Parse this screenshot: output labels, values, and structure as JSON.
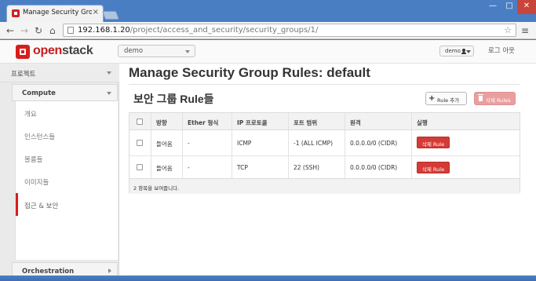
{
  "browser": {
    "tab_title": "Manage Security Group R",
    "tab_close": "×",
    "url_host": "192.168.1.20",
    "url_path": "/project/access_and_security/security_groups/1/",
    "window_min": "—",
    "window_max": "□",
    "window_close": "✕"
  },
  "topbar": {
    "logo_red": "open",
    "logo_dark": "stack",
    "project_select": "demo",
    "user": "demo",
    "logout": "로그 아웃"
  },
  "sidebar": {
    "header": "프로젝트",
    "compute": "Compute",
    "items": [
      {
        "label": "개요"
      },
      {
        "label": "인스턴스들"
      },
      {
        "label": "볼륨들"
      },
      {
        "label": "이미지들"
      },
      {
        "label": "접근 & 보안",
        "active": true
      }
    ],
    "orchestration": "Orchestration"
  },
  "main": {
    "page_title": "Manage Security Group Rules: default",
    "section_title": "보안 그룹 Rule들",
    "add_rule_label": "Rule 추가",
    "delete_rules_label": "삭제 Rules",
    "table": {
      "columns": [
        "방향",
        "Ether 형식",
        "IP 프로토콜",
        "포트 범위",
        "원격",
        "실행"
      ],
      "rows": [
        {
          "direction": "들어옴",
          "ether": "-",
          "protocol": "ICMP",
          "port": "-1 (ALL ICMP)",
          "remote": "0.0.0.0/0 (CIDR)",
          "action": "삭제 Rule"
        },
        {
          "direction": "들어옴",
          "ether": "-",
          "protocol": "TCP",
          "port": "22 (SSH)",
          "remote": "0.0.0.0/0 (CIDR)",
          "action": "삭제 Rule"
        }
      ],
      "footer": "2 항목을 보여줍니다."
    }
  },
  "colors": {
    "brand_red": "#d71e1e",
    "danger_button": "#d53b36",
    "danger_disabled": "#e99f9f"
  }
}
